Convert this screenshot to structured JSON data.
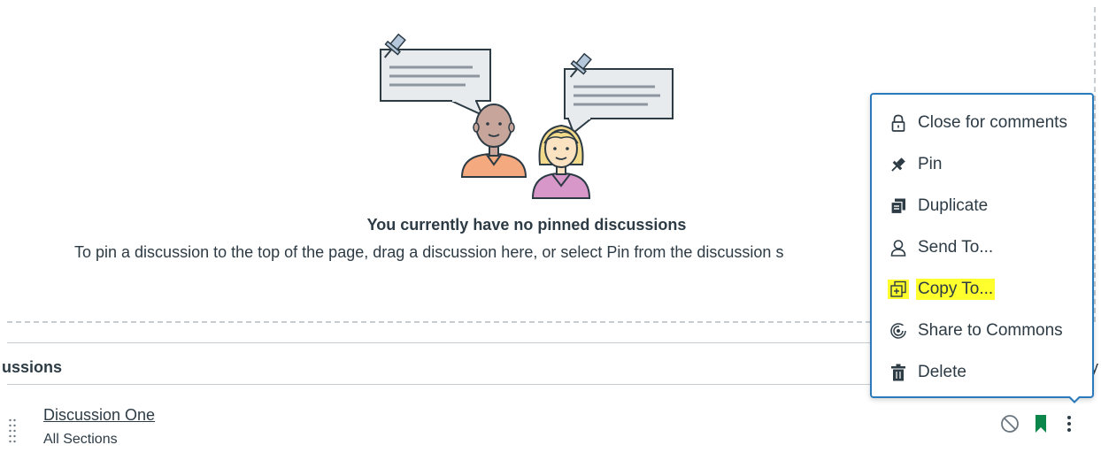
{
  "empty_state": {
    "title": "You currently have no pinned discussions",
    "description": "To pin a discussion to the top of the page, drag a discussion here, or select Pin from the discussion s"
  },
  "section": {
    "header": "ussions",
    "right_fragment": "y"
  },
  "discussion": {
    "title": "Discussion One",
    "subtitle": "All Sections",
    "icons": [
      "disabled-icon",
      "bookmark-icon",
      "kebab-menu-icon"
    ],
    "bookmark_color": "#0b874b"
  },
  "menu": {
    "border_color": "#2b7abc",
    "highlight_color": "#ffff2e",
    "items": [
      {
        "label": "Close for comments",
        "icon": "lock-icon"
      },
      {
        "label": "Pin",
        "icon": "pushpin-icon"
      },
      {
        "label": "Duplicate",
        "icon": "duplicate-icon"
      },
      {
        "label": "Send To...",
        "icon": "user-icon"
      },
      {
        "label": "Copy To...",
        "icon": "copy-icon",
        "highlighted": true
      },
      {
        "label": "Share to Commons",
        "icon": "commons-icon"
      },
      {
        "label": "Delete",
        "icon": "trash-icon"
      }
    ]
  }
}
